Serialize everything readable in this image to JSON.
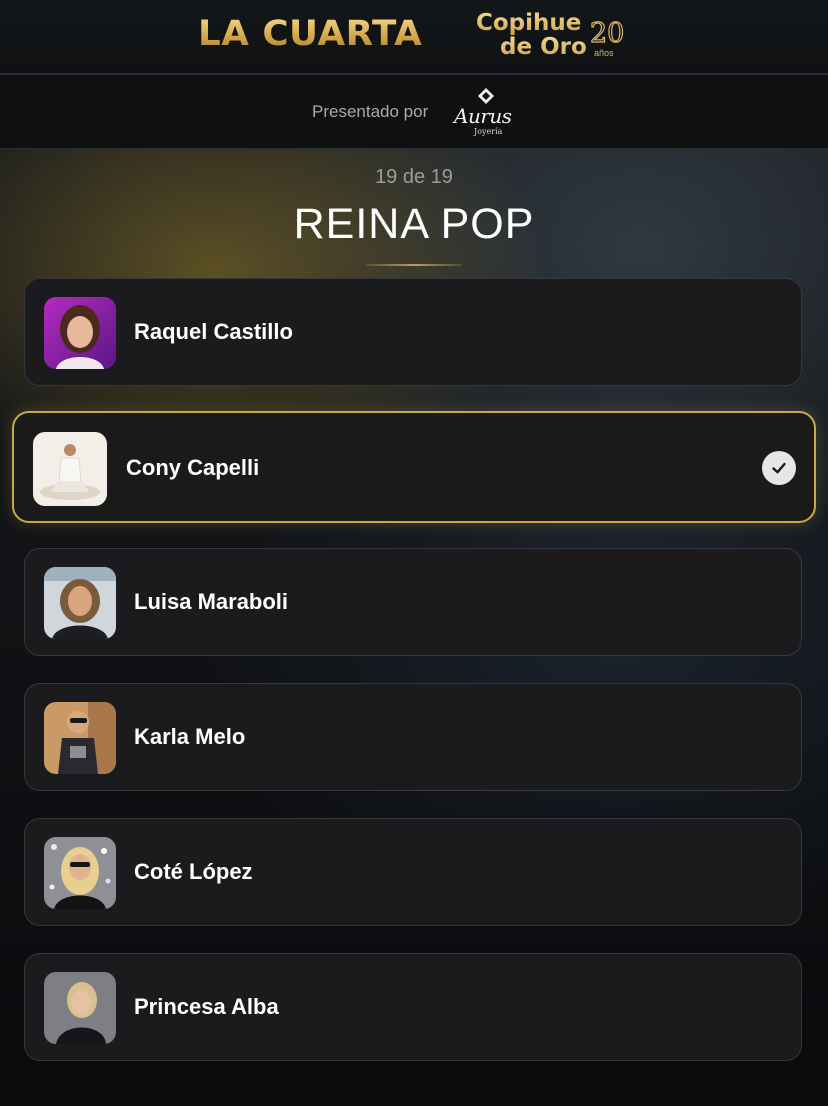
{
  "header": {
    "brand_left": "LA CUARTA",
    "brand_right_line1": "Copihue",
    "brand_right_line2": "de Oro",
    "brand_right_badge": "20",
    "brand_right_badge_sub": "años",
    "presented_by_label": "Presentado por",
    "sponsor_name": "Aurus",
    "sponsor_sub": "Joyería"
  },
  "category": {
    "counter": "19 de 19",
    "title": "REINA POP"
  },
  "nominees": [
    {
      "name": "Raquel Castillo",
      "selected": false,
      "avatar": "portrait-purple-bg"
    },
    {
      "name": "Cony Capelli",
      "selected": true,
      "avatar": "portrait-white-bg"
    },
    {
      "name": "Luisa Maraboli",
      "selected": false,
      "avatar": "portrait-studio"
    },
    {
      "name": "Karla Melo",
      "selected": false,
      "avatar": "portrait-warm-bg"
    },
    {
      "name": "Coté López",
      "selected": false,
      "avatar": "portrait-sparkle-bg"
    },
    {
      "name": "Princesa Alba",
      "selected": false,
      "avatar": "portrait-gray-bg"
    }
  ],
  "colors": {
    "accent_gold": "#c9a84a",
    "card_bg": "#1b1b1d",
    "page_bg": "#0b0c0f"
  },
  "icons": {
    "selected_indicator": "check-icon",
    "sponsor_mark": "diamond-icon"
  }
}
